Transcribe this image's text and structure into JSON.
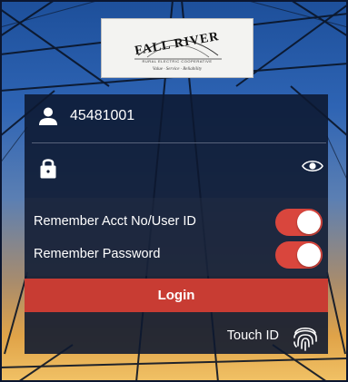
{
  "logo": {
    "title": "FALL RIVER",
    "subtitle": "RURAL ELECTRIC COOPERATIVE",
    "tagline": "Value · Service · Reliability"
  },
  "login_form": {
    "account_icon": "person-icon",
    "account_value": "45481001",
    "password_icon": "lock-icon",
    "password_value": "",
    "show_password_icon": "eye-icon"
  },
  "options": {
    "remember_account_label": "Remember Acct No/User ID",
    "remember_account_on": true,
    "remember_password_label": "Remember Password",
    "remember_password_on": true
  },
  "actions": {
    "login_label": "Login",
    "touch_id_label": "Touch ID",
    "touch_id_icon": "fingerprint-icon"
  },
  "colors": {
    "accent_red": "#c83c33",
    "toggle_on": "#d9463d",
    "panel": "#0c1830"
  }
}
